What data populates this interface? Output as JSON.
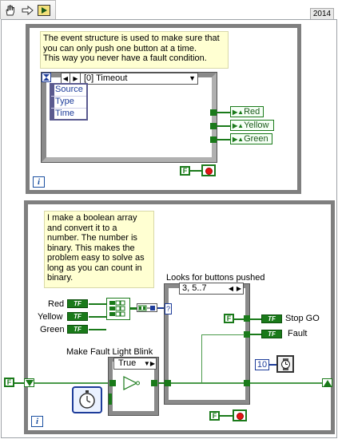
{
  "toolbar": {
    "icons": [
      "hand-tool-icon",
      "arrow-icon",
      "run-arrow-icon"
    ]
  },
  "version_tab": "2014",
  "event_loop": {
    "comment": "The event structure is used to make sure that\nyou can only push one button at a time.\nThis way you never have a fault condition.",
    "event_case": "[0] Timeout",
    "event_data_fields": [
      "Source",
      "Type",
      "Time"
    ],
    "outputs": [
      "Red",
      "Yellow",
      "Green"
    ],
    "stop_constant": "F"
  },
  "main_loop": {
    "comment": "I make a boolean array\nand convert it to a\nnumber. The number is\nbinary. This makes the\nproblem easy to solve as\nlong as you can count in\nbinary.",
    "inputs": [
      "Red",
      "Yellow",
      "Green"
    ],
    "input_terminal_text": "TF",
    "case_label": "Looks for buttons pushed",
    "case_selector": "3, 5..7",
    "case_terminal": "?",
    "blink_label": "Make Fault Light Blink",
    "blink_case_selector": "True",
    "stop_go_label": "Stop GO",
    "fault_label": "Fault",
    "case_false_constant": "F",
    "wait_ms": "10",
    "shift_register_constant": "F",
    "stop_constant": "F"
  }
}
